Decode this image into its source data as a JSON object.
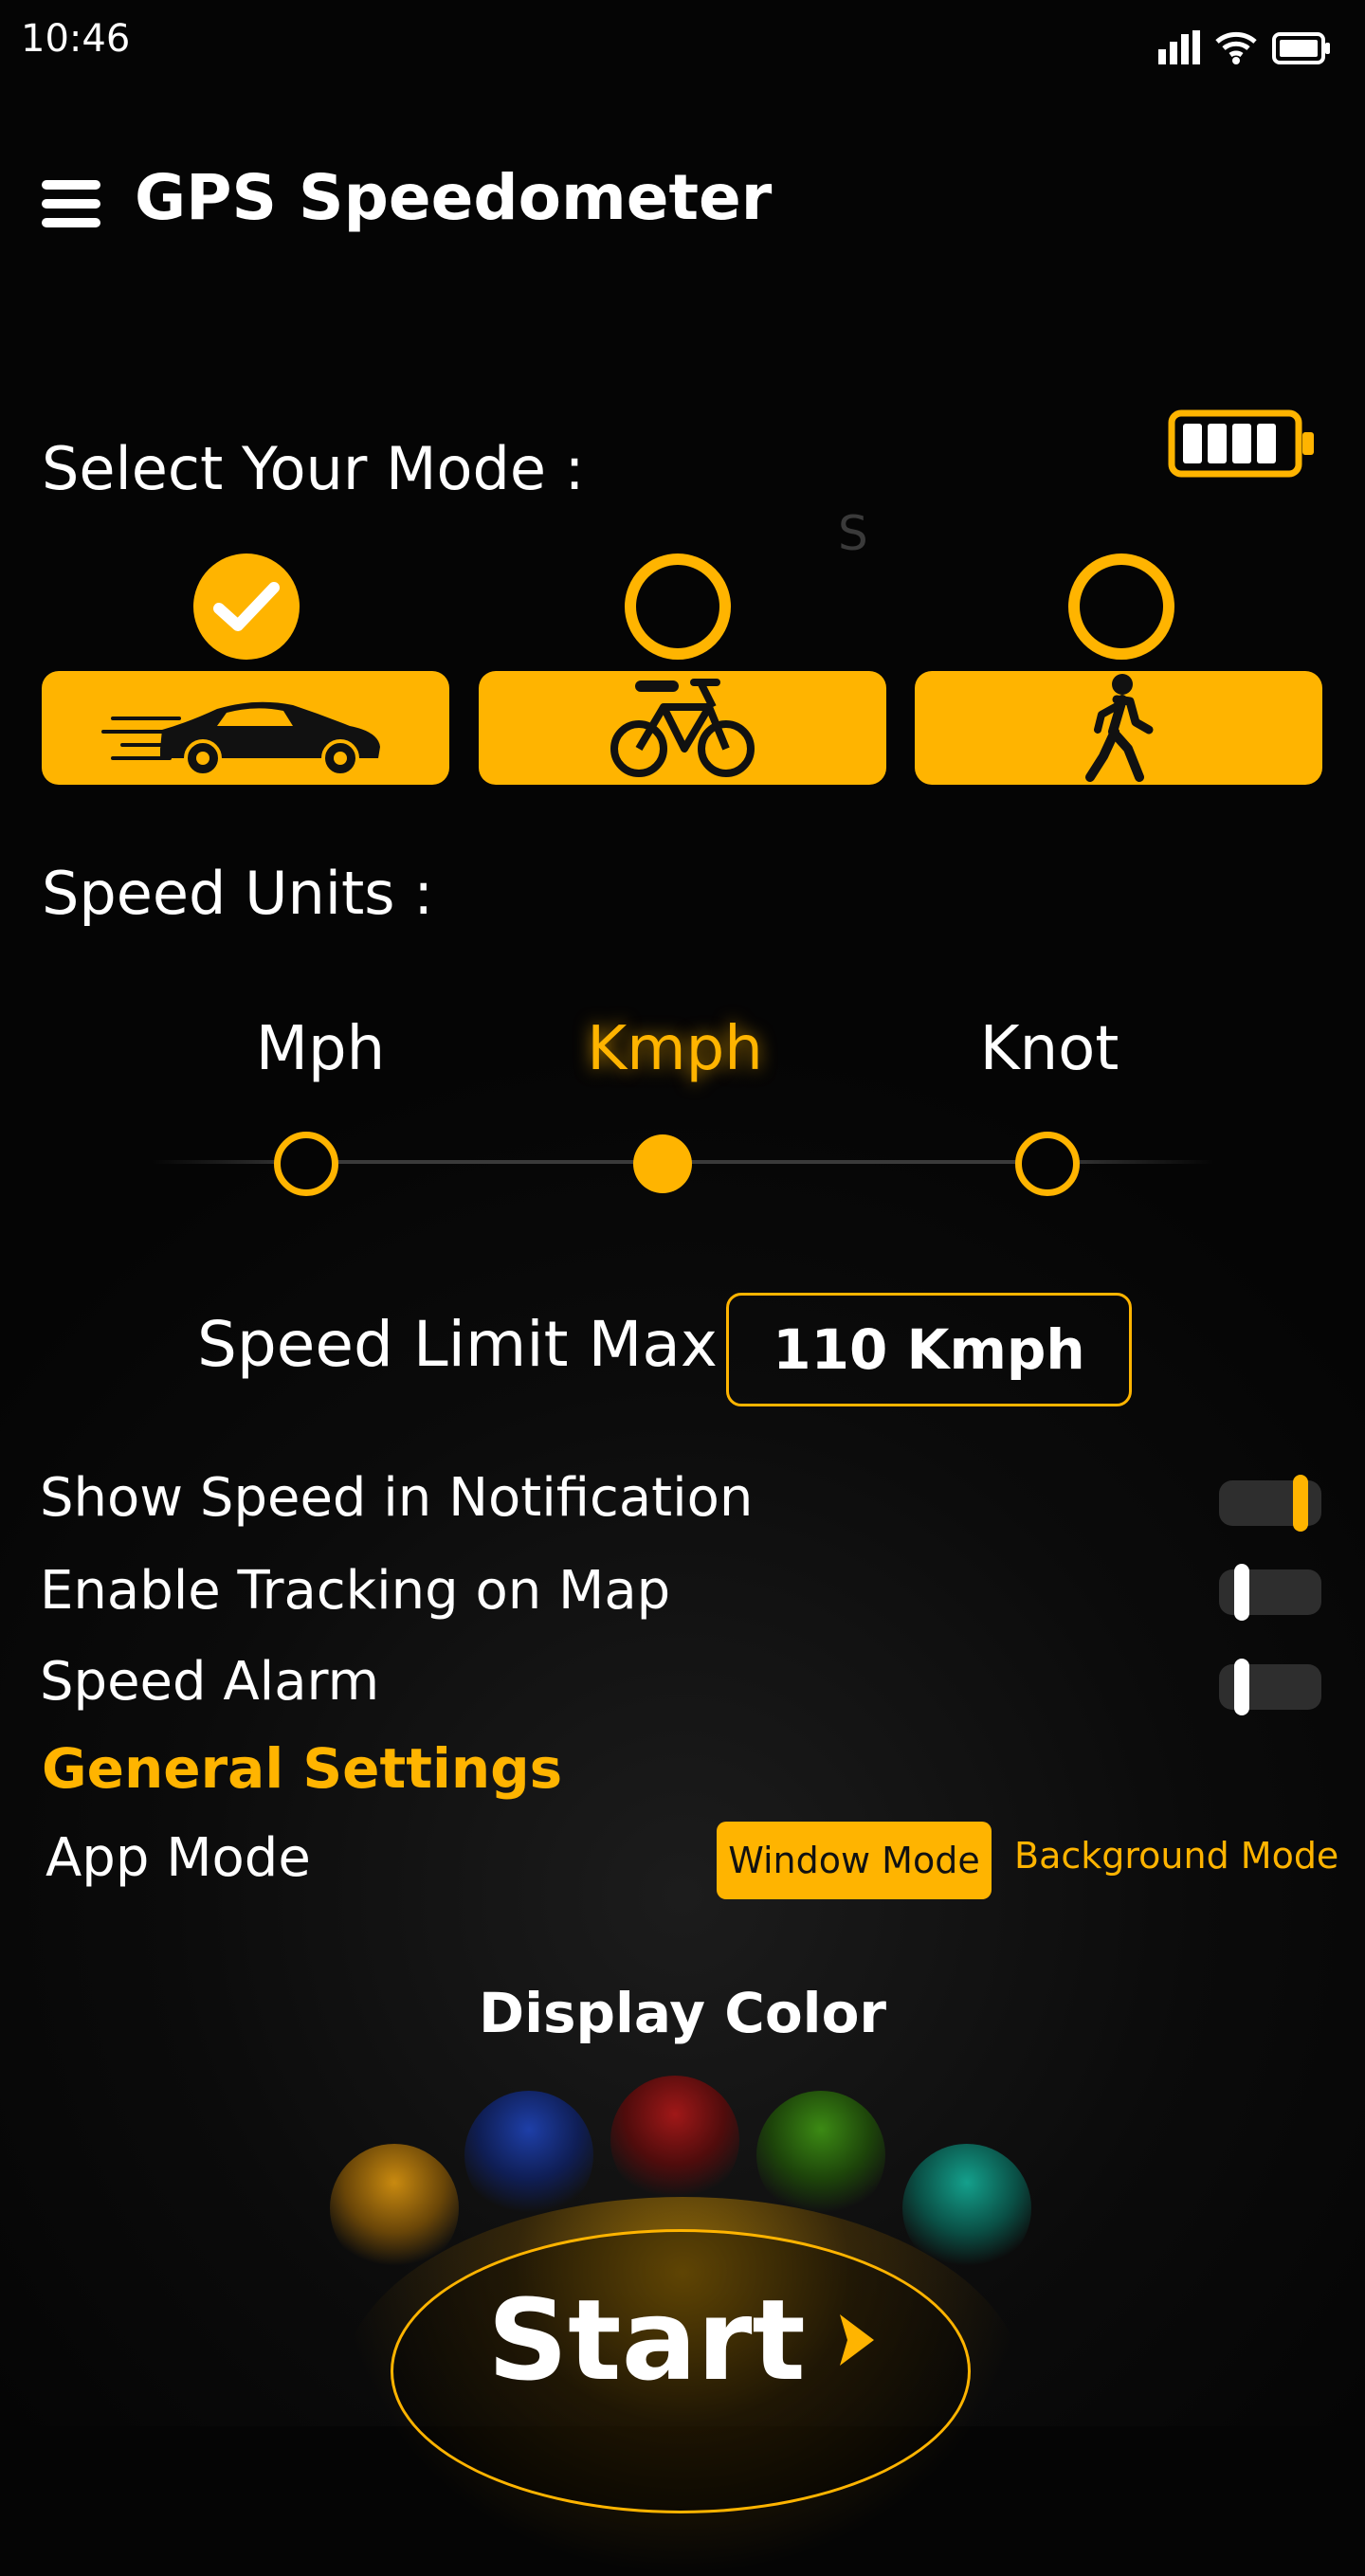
{
  "status_bar": {
    "time": "10:46",
    "icons": [
      "signal-icon",
      "wifi-icon",
      "battery-full-icon"
    ]
  },
  "app_bar": {
    "title": "GPS Speedometer",
    "menu_icon": "hamburger-menu-icon"
  },
  "mode_section": {
    "title": "Select Your Mode :",
    "stray_text": "S",
    "modes": [
      {
        "icon": "car-icon",
        "selected": true
      },
      {
        "icon": "bicycle-icon",
        "selected": false
      },
      {
        "icon": "walking-person-icon",
        "selected": false
      }
    ]
  },
  "units_section": {
    "title": "Speed Units :",
    "units": [
      {
        "label": "Mph",
        "selected": false
      },
      {
        "label": "Kmph",
        "selected": true
      },
      {
        "label": "Knot",
        "selected": false
      }
    ]
  },
  "speed_limit": {
    "label": "Speed Limit Max",
    "value": "110 Kmph"
  },
  "settings": [
    {
      "label": "Show Speed in Notification",
      "enabled": true
    },
    {
      "label": "Enable Tracking on Map",
      "enabled": false
    },
    {
      "label": "Speed Alarm",
      "enabled": false
    }
  ],
  "general_settings": {
    "title": "General Settings",
    "app_mode_label": "App Mode",
    "modes": [
      "Window Mode",
      "Background Mode"
    ],
    "selected_mode": "Window Mode"
  },
  "display_color": {
    "title": "Display Color",
    "colors": [
      "#C98A10",
      "#1E3FA8",
      "#A01818",
      "#3C8A14",
      "#14A08C"
    ]
  },
  "start_button": {
    "label": "Start"
  },
  "accent_color": "#FFB400"
}
